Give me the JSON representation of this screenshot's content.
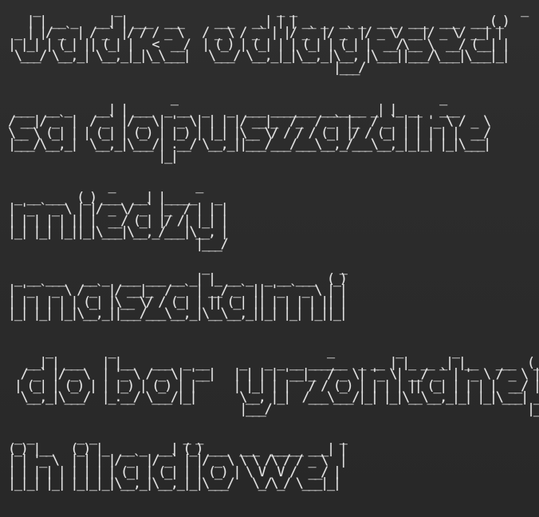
{
  "terminal": {
    "background": "#2b2b2b",
    "foreground": "#e6e6e6",
    "blocks": [
      {
        "text": "    _            _                         _ _                                    _\n   | | __ _   __| | ___  ___     ___   __| | | __ _  __ _  ___  ___  ___  ___(_)\n _ | |/ _` | / _` |/ / / _ \\   / _ \\ / _` | |/ _` |/ _` |/ _ \\/ __|/ _ \\/ __| |\n| |_| | (_| || (_| |   <  __/  | (_) | (_| | | (_| | (_| |  __/\\__ \\  __/ (__| |\n \\___/ \\__,_| \\__,_|_|\\_\\___|   \\___/ \\__,_|_|\\__,_|\\__, |\\___||___/\\___|\\___|_|\n                                                    |___/"
      },
      {
        "text": "                          _                                          _\n ___  __ _    __| | ___  _ __  _   _  ___ _______ _______ _| |_ __   ___\n/ __|/ _` |  / _` |/ _ \\| '_ \\| | | |/ __|_  /_  / _` |_  / _` | | '_ \\ / _ \\\n\\__ \\ (_| | | (_| | (_) | |_) | |_| |\\__ \\/ / / / (_| |/ / (_| | | | | |  __/\n|___/\\__,_|  \\__,_|\\___/| .__/ \\__,_||___/___/___\\__,_/___\\__,_|_|_| |_|\\___|\n                        |_|"
      },
      {
        "text": "                _             _\n _ __ ___  (_) ___  __| |_____   _\n| '_ ` _ \\ | |/ _ \\/ _` |_  / | | |\n| | | | | || |  __/ (_| |/ /| |_| |\n|_| |_| |_||_|\\___|\\__,_/___|\\__, |\n                              |___/"
      },
      {
        "text": "                               _                     _\n _ __ ___   __ _  ___ ___ __ _| |_ __ _  _ __ ___  (_)\n| '_ ` _ \\ / _` |/ __|_  / _` | __/ _` || '_ ` _ \\ | |\n| | | | | | (_| |\\__ \\/ / (_| | || (_| || | | | | || |\n|_| |_| |_|\\__,_||___/___\\__,_|\\__\\__,_||_| |_| |_||_|"
      },
      {
        "text": "      _         _                                  _          _        _              _\n   __| | ___   | |__   ___  _ __     _   _ _ __ ______  _ __ | |_ __ _| |__   ___  (_)\n  / _` |/ _ \\  | '_ \\ / _ \\| '__|   | | | | '__|_  / _ \\| '_ \\| __/ _` | '_ \\ / _ \\ | |\n | (_| | (_) | | |_) | (_) | |      | |_| | |   / / (_) | | | | || (_| | | | |  __/ | |\n  \\__,_|\\___/  |_.__/ \\___/|_|       \\__, |_|  /___\\___/|_| |_|\\__\\__,_|_| |_|\\___| _/ |\n                                     |___/                                         |__/"
      },
      {
        "text": " _ _       _ _              _ _                      _\n(_) |__   (_) |_  __ _  __| (_) ___  ___  _____ ___| |\n| | '_ \\  | | | |/ _` |/ _` | |/ _ \\ \\ \\ /\\ / / _ \\  |\n| | | | | | | | | (_| | (_| | | (_) | \\ V  V /  __/ |\n|_|_| |_| |_|_|_|\\__,_|\\__,_|_|\\___/   \\_/\\_/ \\___|_|"
      }
    ]
  }
}
